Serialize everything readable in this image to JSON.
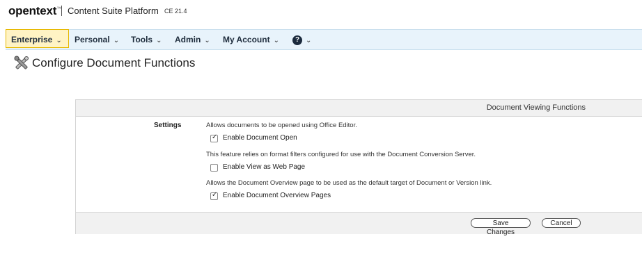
{
  "header": {
    "logo": "opentext",
    "logo_tm": "™",
    "product": "Content Suite Platform",
    "version": "CE 21.4"
  },
  "nav": {
    "items": [
      {
        "label": "Enterprise"
      },
      {
        "label": "Personal"
      },
      {
        "label": "Tools"
      },
      {
        "label": "Admin"
      },
      {
        "label": "My Account"
      }
    ],
    "help_glyph": "?"
  },
  "page": {
    "title": "Configure Document Functions",
    "icon": "tools-icon"
  },
  "panel": {
    "heading": "Document Viewing Functions",
    "settings_label": "Settings",
    "options": [
      {
        "description": "Allows documents to be opened using Office Editor.",
        "label": "Enable Document Open",
        "checked": true
      },
      {
        "description": "This feature relies on format filters configured for use with the Document Conversion Server.",
        "label": "Enable View as Web Page",
        "checked": false
      },
      {
        "description": "Allows the Document Overview page to be used as the default target of Document or Version link.",
        "label": "Enable Document Overview Pages",
        "checked": true
      }
    ],
    "save_label": "Save Changes",
    "cancel_label": "Cancel"
  },
  "colors": {
    "nav_bg": "#e8f3fb",
    "nav_active_bg": "#fff3c4",
    "nav_active_border": "#e6b800"
  }
}
